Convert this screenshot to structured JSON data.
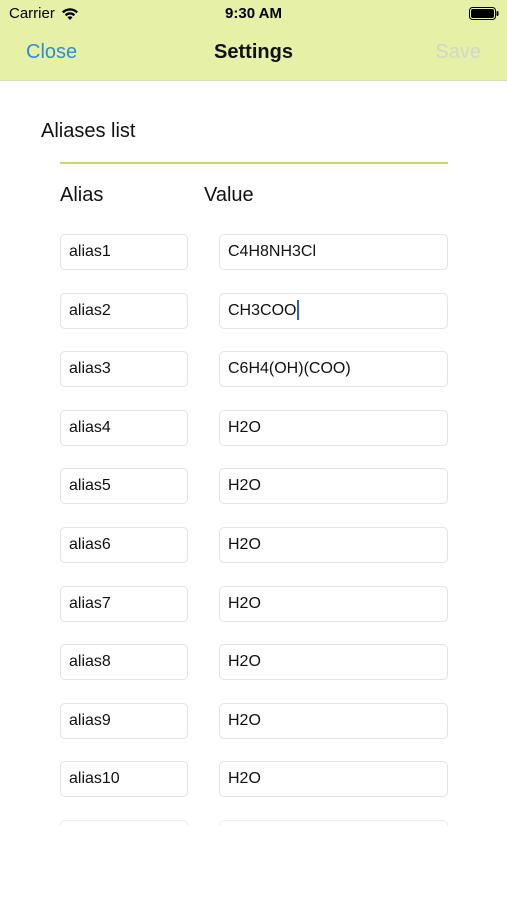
{
  "status_bar": {
    "carrier": "Carrier",
    "time": "9:30 AM",
    "wifi_icon": "wifi-icon",
    "battery_icon": "battery-icon"
  },
  "nav": {
    "close_label": "Close",
    "title": "Settings",
    "save_label": "Save"
  },
  "section": {
    "title": "Aliases list"
  },
  "columns": {
    "alias_header": "Alias",
    "value_header": "Value"
  },
  "rows": [
    {
      "alias": "alias1",
      "value": "C4H8NH3Cl"
    },
    {
      "alias": "alias2",
      "value": "CH3COO"
    },
    {
      "alias": "alias3",
      "value": "C6H4(OH)(COO)"
    },
    {
      "alias": "alias4",
      "value": "H2O"
    },
    {
      "alias": "alias5",
      "value": "H2O"
    },
    {
      "alias": "alias6",
      "value": "H2O"
    },
    {
      "alias": "alias7",
      "value": "H2O"
    },
    {
      "alias": "alias8",
      "value": "H2O"
    },
    {
      "alias": "alias9",
      "value": "H2O"
    },
    {
      "alias": "alias10",
      "value": "H2O"
    }
  ],
  "colors": {
    "nav_background": "#e6f0a7",
    "accent": "#2a8fd6",
    "divider": "#c9d86a",
    "disabled": "#cfd8c6"
  }
}
